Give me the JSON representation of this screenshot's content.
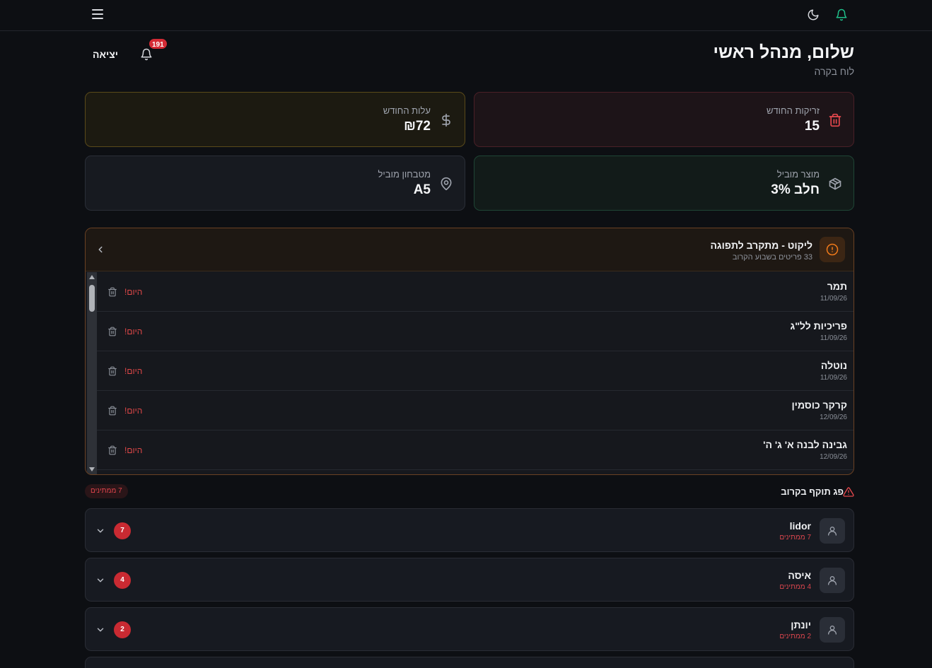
{
  "topbar": {
    "menu_icon": "menu-icon",
    "theme_icon": "moon-icon",
    "bell_icon": "bell-icon",
    "bell_color": "#1fbf8a"
  },
  "header": {
    "greeting": "שלום, מנהל ראשי",
    "subtitle": "לוח בקרה",
    "logout_label": "יציאה",
    "notification_count": "191"
  },
  "stats": {
    "waste": {
      "label": "זריקות החודש",
      "value": "15",
      "icon": "trash-icon",
      "color": "#e5484d"
    },
    "cost": {
      "label": "עלות החודש",
      "value": "₪72",
      "icon": "dollar-icon",
      "color": "#d4a72c"
    },
    "top_product": {
      "label": "מוצר מוביל",
      "value": "חלב 3%",
      "icon": "box-icon",
      "color": "#2fb27a"
    },
    "top_kitchen": {
      "label": "מטבחון מוביל",
      "value": "A5",
      "icon": "map-pin-icon",
      "color": "#9aa0aa"
    }
  },
  "expiry": {
    "title": "ליקוט - מתקרב לתפוגה",
    "subtitle": "33 פריטים בשבוע הקרוב",
    "accent": "#f07a1a",
    "items": [
      {
        "name": "תמר",
        "date": "11/09/26",
        "status": "היום!"
      },
      {
        "name": "פריכיות לל\"ג",
        "date": "11/09/26",
        "status": "היום!"
      },
      {
        "name": "נוטלה",
        "date": "11/09/26",
        "status": "היום!"
      },
      {
        "name": "קרקר כוסמין",
        "date": "12/09/26",
        "status": "היום!"
      },
      {
        "name": "גבינה לבנה א' ג' ה'",
        "date": "12/09/26",
        "status": "היום!"
      }
    ]
  },
  "pending": {
    "title": "פג תוקף בקרוב",
    "badge": "7 ממתינים",
    "people": [
      {
        "name": "lidor",
        "waiting": "7 ממתינים",
        "count": "7"
      },
      {
        "name": "איסה",
        "waiting": "4 ממתינים",
        "count": "4"
      },
      {
        "name": "יונתן",
        "waiting": "2 ממתינים",
        "count": "2"
      }
    ]
  }
}
